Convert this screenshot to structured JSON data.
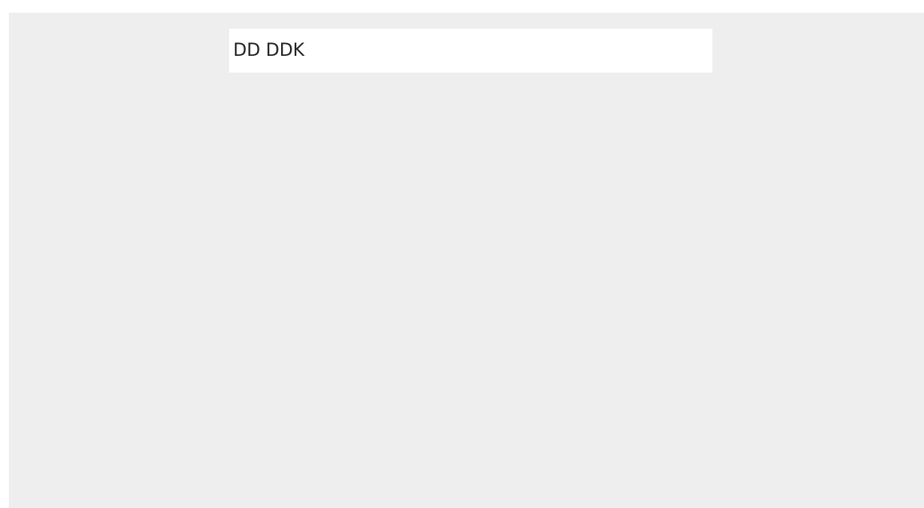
{
  "panel": {
    "background": "#eeeeee"
  },
  "text_field": {
    "value": "DD DDK",
    "background": "#ffffff"
  }
}
